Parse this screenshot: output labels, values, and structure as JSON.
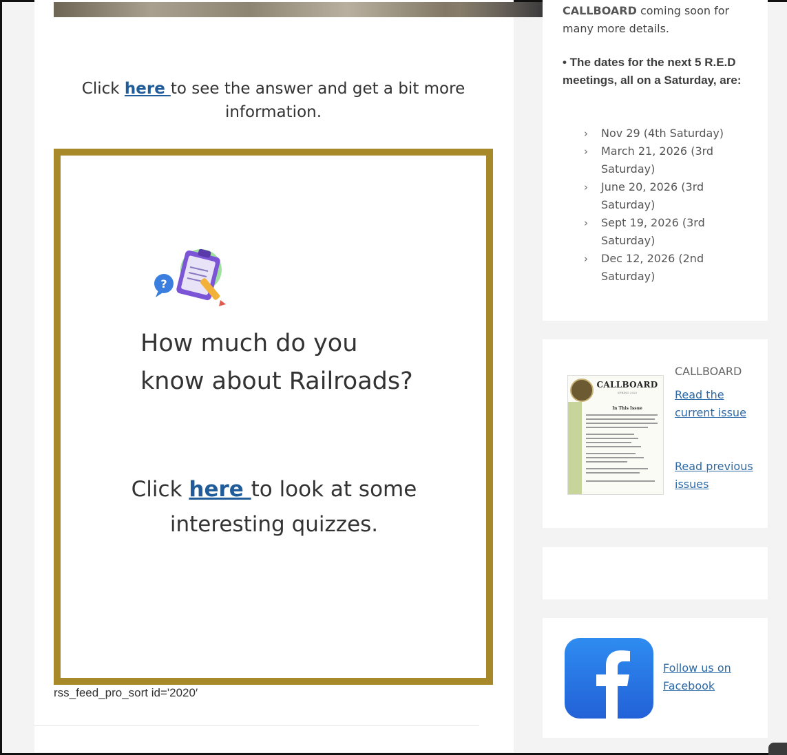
{
  "main": {
    "answer": {
      "before": "Click ",
      "link": "here ",
      "after": "to see the answer and get a bit more information."
    },
    "quiz": {
      "heading": "How much do you know about Railroads?",
      "cta_before": "Click ",
      "cta_link": "here ",
      "cta_after": "to look at some interesting quizzes."
    },
    "rss_shortcode": "rss_feed_pro_sort id='2020′"
  },
  "sidebar": {
    "callboard_soon": {
      "cut_word": "CALLBOARD",
      "rest": " coming soon for many more details."
    },
    "dates_intro": "• The dates for the next 5 R.E.D meetings, all on a Saturday, are:",
    "dates": [
      "Nov 29 (4th Saturday)",
      "March 21, 2026 (3rd Saturday)",
      "June 20, 2026 (3rd Saturday)",
      "Sept 19, 2026 (3rd Saturday)",
      "Dec 12, 2026 (2nd Saturday)"
    ],
    "callboard": {
      "label": "CALLBOARD",
      "read_current": "Read the current issue",
      "read_previous": "Read previous issues",
      "thumb_masthead": "CALLBOARD",
      "thumb_issue": "SPRING 2025",
      "thumb_section": "In This Issue"
    },
    "facebook": {
      "follow": "Follow us on Facebook",
      "glyph": "f"
    }
  },
  "colors": {
    "quiz_border": "#a8892a",
    "link": "#1f5c99",
    "sidebar_link": "#2c6aa8",
    "facebook_blue": "#2361d8"
  },
  "icons": [
    "clipboard-quiz-icon",
    "chevron-right-icon",
    "facebook-icon"
  ]
}
